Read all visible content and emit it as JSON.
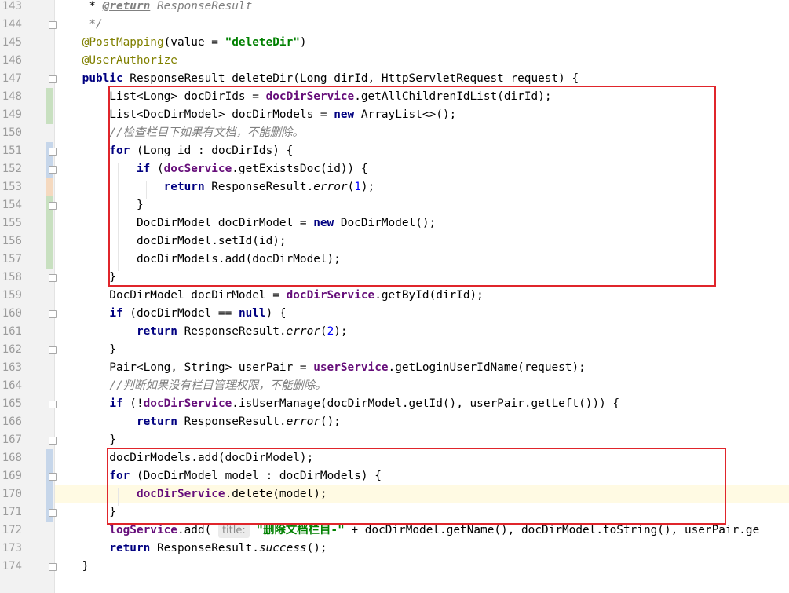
{
  "editor": {
    "lines": [
      {
        "num": "143",
        "fold": false,
        "change": "",
        "tokens": [
          {
            "t": "     * "
          },
          {
            "t": "@return",
            "c": "doctag"
          },
          {
            "t": " ResponseResult",
            "c": "cmt"
          }
        ]
      },
      {
        "num": "144",
        "fold": true,
        "change": "",
        "tokens": [
          {
            "t": "     */",
            "c": "cmt"
          }
        ]
      },
      {
        "num": "145",
        "fold": false,
        "change": "",
        "tokens": [
          {
            "t": "    "
          },
          {
            "t": "@PostMapping",
            "c": "ann"
          },
          {
            "t": "(value = "
          },
          {
            "t": "\"deleteDir\"",
            "c": "str"
          },
          {
            "t": ")"
          }
        ]
      },
      {
        "num": "146",
        "fold": false,
        "change": "",
        "tokens": [
          {
            "t": "    "
          },
          {
            "t": "@UserAuthorize",
            "c": "ann"
          }
        ]
      },
      {
        "num": "147",
        "fold": true,
        "change": "",
        "tokens": [
          {
            "t": "    "
          },
          {
            "t": "public",
            "c": "kw"
          },
          {
            "t": " ResponseResult deleteDir(Long dirId, HttpServletRequest request) {"
          }
        ]
      },
      {
        "num": "148",
        "fold": false,
        "change": "added",
        "tokens": [
          {
            "t": "        List<Long> docDirIds = "
          },
          {
            "t": "docDirService",
            "c": "fld"
          },
          {
            "t": ".getAllChildrenIdList(dirId);"
          }
        ]
      },
      {
        "num": "149",
        "fold": false,
        "change": "added",
        "tokens": [
          {
            "t": "        List<DocDirModel> docDirModels = "
          },
          {
            "t": "new",
            "c": "kw"
          },
          {
            "t": " ArrayList<>();"
          }
        ]
      },
      {
        "num": "150",
        "fold": false,
        "change": "",
        "tokens": [
          {
            "t": "        "
          },
          {
            "t": "//检查栏目下如果有文档，不能删除。",
            "c": "cmt"
          }
        ]
      },
      {
        "num": "151",
        "fold": true,
        "change": "modified",
        "tokens": [
          {
            "t": "        "
          },
          {
            "t": "for",
            "c": "kw"
          },
          {
            "t": " (Long id : docDirIds) {"
          }
        ]
      },
      {
        "num": "152",
        "fold": true,
        "change": "modified",
        "tokens": [
          {
            "t": "            "
          },
          {
            "t": "if",
            "c": "kw"
          },
          {
            "t": " ("
          },
          {
            "t": "docService",
            "c": "fld"
          },
          {
            "t": ".getExistsDoc(id)) {"
          }
        ]
      },
      {
        "num": "153",
        "fold": false,
        "change": "conflict",
        "tokens": [
          {
            "t": "                "
          },
          {
            "t": "return",
            "c": "kw"
          },
          {
            "t": " ResponseResult."
          },
          {
            "t": "error",
            "c": "itl"
          },
          {
            "t": "("
          },
          {
            "t": "1",
            "c": "num"
          },
          {
            "t": ");"
          }
        ]
      },
      {
        "num": "154",
        "fold": true,
        "change": "added",
        "tokens": [
          {
            "t": "            }"
          }
        ]
      },
      {
        "num": "155",
        "fold": false,
        "change": "added",
        "tokens": [
          {
            "t": "            DocDirModel docDirModel = "
          },
          {
            "t": "new",
            "c": "kw"
          },
          {
            "t": " DocDirModel();"
          }
        ]
      },
      {
        "num": "156",
        "fold": false,
        "change": "added",
        "tokens": [
          {
            "t": "            docDirModel.setId(id);"
          }
        ]
      },
      {
        "num": "157",
        "fold": false,
        "change": "added",
        "tokens": [
          {
            "t": "            docDirModels.add(docDirModel);"
          }
        ]
      },
      {
        "num": "158",
        "fold": true,
        "change": "",
        "tokens": [
          {
            "t": "        }"
          }
        ]
      },
      {
        "num": "159",
        "fold": false,
        "change": "",
        "tokens": [
          {
            "t": "        DocDirModel docDirModel = "
          },
          {
            "t": "docDirService",
            "c": "fld"
          },
          {
            "t": ".getById(dirId);"
          }
        ]
      },
      {
        "num": "160",
        "fold": true,
        "change": "",
        "tokens": [
          {
            "t": "        "
          },
          {
            "t": "if",
            "c": "kw"
          },
          {
            "t": " (docDirModel == "
          },
          {
            "t": "null",
            "c": "kw"
          },
          {
            "t": ") {"
          }
        ]
      },
      {
        "num": "161",
        "fold": false,
        "change": "",
        "tokens": [
          {
            "t": "            "
          },
          {
            "t": "return",
            "c": "kw"
          },
          {
            "t": " ResponseResult."
          },
          {
            "t": "error",
            "c": "itl"
          },
          {
            "t": "("
          },
          {
            "t": "2",
            "c": "num"
          },
          {
            "t": ");"
          }
        ]
      },
      {
        "num": "162",
        "fold": true,
        "change": "",
        "tokens": [
          {
            "t": "        }"
          }
        ]
      },
      {
        "num": "163",
        "fold": false,
        "change": "",
        "tokens": [
          {
            "t": "        Pair<Long, String> userPair = "
          },
          {
            "t": "userService",
            "c": "fld"
          },
          {
            "t": ".getLoginUserIdName(request);"
          }
        ]
      },
      {
        "num": "164",
        "fold": false,
        "change": "",
        "tokens": [
          {
            "t": "        "
          },
          {
            "t": "//判断如果没有栏目管理权限，不能删除。",
            "c": "cmt"
          }
        ]
      },
      {
        "num": "165",
        "fold": true,
        "change": "",
        "tokens": [
          {
            "t": "        "
          },
          {
            "t": "if",
            "c": "kw"
          },
          {
            "t": " (!"
          },
          {
            "t": "docDirService",
            "c": "fld"
          },
          {
            "t": ".isUserManage(docDirModel.getId(), userPair.getLeft())) {"
          }
        ]
      },
      {
        "num": "166",
        "fold": false,
        "change": "",
        "tokens": [
          {
            "t": "            "
          },
          {
            "t": "return",
            "c": "kw"
          },
          {
            "t": " ResponseResult."
          },
          {
            "t": "error",
            "c": "itl"
          },
          {
            "t": "();"
          }
        ]
      },
      {
        "num": "167",
        "fold": true,
        "change": "",
        "tokens": [
          {
            "t": "        }"
          }
        ]
      },
      {
        "num": "168",
        "fold": false,
        "change": "modified",
        "tokens": [
          {
            "t": "        docDirModels.add(docDirModel);"
          }
        ]
      },
      {
        "num": "169",
        "fold": true,
        "change": "modified",
        "tokens": [
          {
            "t": "        "
          },
          {
            "t": "for",
            "c": "kw"
          },
          {
            "t": " (DocDirModel model : docDirModels) {"
          }
        ]
      },
      {
        "num": "170",
        "fold": false,
        "change": "modified",
        "current": true,
        "tokens": [
          {
            "t": "            "
          },
          {
            "t": "docDirService",
            "c": "fld"
          },
          {
            "t": ".delete(model);"
          }
        ]
      },
      {
        "num": "171",
        "fold": true,
        "change": "modified",
        "tokens": [
          {
            "t": "        }"
          }
        ]
      },
      {
        "num": "172",
        "fold": false,
        "change": "",
        "tokens": [
          {
            "t": "        "
          },
          {
            "t": "logService",
            "c": "fld"
          },
          {
            "t": ".add( "
          },
          {
            "t": "title:",
            "c": "hint"
          },
          {
            "t": " "
          },
          {
            "t": "\"删除文档栏目-\"",
            "c": "str"
          },
          {
            "t": " + docDirModel.getName(), docDirModel.toString(), userPair.ge"
          }
        ]
      },
      {
        "num": "173",
        "fold": false,
        "change": "",
        "tokens": [
          {
            "t": "        "
          },
          {
            "t": "return",
            "c": "kw"
          },
          {
            "t": " ResponseResult."
          },
          {
            "t": "success",
            "c": "itl"
          },
          {
            "t": "();"
          }
        ]
      },
      {
        "num": "174",
        "fold": true,
        "change": "",
        "tokens": [
          {
            "t": "    }"
          }
        ]
      }
    ]
  },
  "annotation_color": "#e0252b",
  "current_line_color": "#fffae3"
}
